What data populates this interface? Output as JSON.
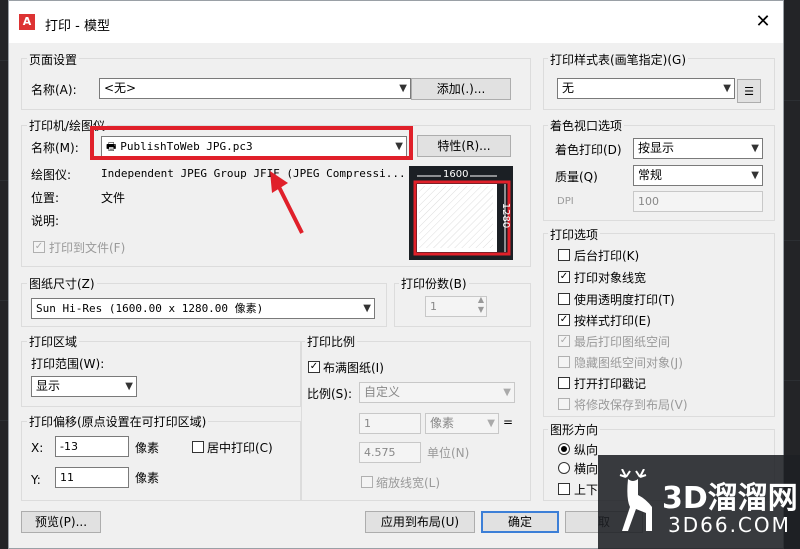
{
  "window": {
    "title": "打印 - 模型",
    "close_icon": "close-icon"
  },
  "page_setup": {
    "legend": "页面设置",
    "name_label": "名称(A):",
    "name_value": "<无>",
    "add_button": "添加(.)..."
  },
  "printer": {
    "legend": "打印机/绘图仪",
    "name_label": "名称(M):",
    "name_value": "PublishToWeb JPG.pc3",
    "properties_button": "特性(R)...",
    "plotter_label": "绘图仪:",
    "plotter_value": "Independent JPEG Group JFIF (JPEG Compressi...",
    "location_label": "位置:",
    "location_value": "文件",
    "description_label": "说明:",
    "print_to_file_label": "打印到文件(F)",
    "print_to_file_checked": true,
    "preview_width_label": "1600",
    "preview_height_label": "1280"
  },
  "paper_size": {
    "legend": "图纸尺寸(Z)",
    "value": "Sun Hi-Res (1600.00 x 1280.00 像素)"
  },
  "copies": {
    "legend": "打印份数(B)",
    "value": "1"
  },
  "plot_area": {
    "legend": "打印区域",
    "range_label": "打印范围(W):",
    "range_value": "显示"
  },
  "plot_offset": {
    "legend": "打印偏移(原点设置在可打印区域)",
    "x_label": "X:",
    "x_value": "-13",
    "x_unit": "像素",
    "y_label": "Y:",
    "y_value": "11",
    "y_unit": "像素",
    "center_label": "居中打印(C)",
    "center_checked": false
  },
  "plot_scale": {
    "legend": "打印比例",
    "fit_label": "布满图纸(I)",
    "fit_checked": true,
    "scale_label": "比例(S):",
    "scale_value": "自定义",
    "value1": "1",
    "unit_value": "像素",
    "equals": "=",
    "value2": "4.575",
    "unit2": "单位(N)",
    "lineweights_label": "缩放线宽(L)"
  },
  "plot_style": {
    "legend": "打印样式表(画笔指定)(G)",
    "value": "无"
  },
  "shaded_viewport": {
    "legend": "着色视口选项",
    "shade_label": "着色打印(D)",
    "shade_value": "按显示",
    "quality_label": "质量(Q)",
    "quality_value": "常规",
    "dpi_label": "DPI",
    "dpi_value": "100"
  },
  "plot_options": {
    "legend": "打印选项",
    "items": [
      {
        "label": "后台打印(K)",
        "checked": false,
        "enabled": true
      },
      {
        "label": "打印对象线宽",
        "checked": true,
        "enabled": true
      },
      {
        "label": "使用透明度打印(T)",
        "checked": false,
        "enabled": true
      },
      {
        "label": "按样式打印(E)",
        "checked": true,
        "enabled": true
      },
      {
        "label": "最后打印图纸空间",
        "checked": true,
        "enabled": false
      },
      {
        "label": "隐藏图纸空间对象(J)",
        "checked": false,
        "enabled": false
      },
      {
        "label": "打开打印戳记",
        "checked": false,
        "enabled": true
      },
      {
        "label": "将修改保存到布局(V)",
        "checked": false,
        "enabled": false
      }
    ]
  },
  "orientation": {
    "legend": "图形方向",
    "portrait": "纵向",
    "landscape": "横向",
    "upside_down": "上下"
  },
  "footer": {
    "preview_button": "预览(P)...",
    "apply_button": "应用到布局(U)",
    "ok_button": "确定",
    "cancel_button": "取"
  },
  "watermark": {
    "text": "3D溜溜网",
    "subtext": "3D66.COM"
  },
  "colors": {
    "highlight": "#e0202a",
    "accent": "#3c7fd7"
  }
}
